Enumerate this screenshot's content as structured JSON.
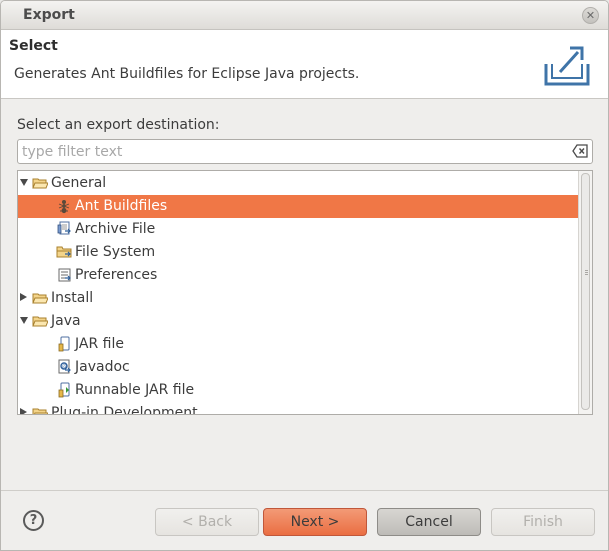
{
  "window": {
    "title": "Export",
    "close_glyph": "✕"
  },
  "header": {
    "title": "Select",
    "description": "Generates Ant Buildfiles for Eclipse Java projects.",
    "graphic_icon": "export-wizard-icon"
  },
  "prompt": "Select an export destination:",
  "filter": {
    "placeholder": "type filter text",
    "value": "",
    "clear_icon": "clear-filter-icon"
  },
  "tree": {
    "items": [
      {
        "label": "General",
        "level": 0,
        "expander": "expanded",
        "icon": "folder-open-icon"
      },
      {
        "label": "Ant Buildfiles",
        "level": 1,
        "icon": "ant-icon",
        "selected": true
      },
      {
        "label": "Archive File",
        "level": 1,
        "icon": "archive-icon"
      },
      {
        "label": "File System",
        "level": 1,
        "icon": "folder-icon"
      },
      {
        "label": "Preferences",
        "level": 1,
        "icon": "preferences-icon"
      },
      {
        "label": "Install",
        "level": 0,
        "expander": "collapsed",
        "icon": "folder-open-icon"
      },
      {
        "label": "Java",
        "level": 0,
        "expander": "expanded",
        "icon": "folder-open-icon"
      },
      {
        "label": "JAR file",
        "level": 1,
        "icon": "jar-icon"
      },
      {
        "label": "Javadoc",
        "level": 1,
        "icon": "javadoc-icon"
      },
      {
        "label": "Runnable JAR file",
        "level": 1,
        "icon": "runnable-jar-icon"
      },
      {
        "label": "Plug-in Development",
        "level": 0,
        "expander": "collapsed",
        "icon": "folder-open-icon"
      }
    ]
  },
  "buttons": {
    "help_glyph": "?",
    "back": "< Back",
    "next": "Next >",
    "cancel": "Cancel",
    "finish": "Finish"
  },
  "colors": {
    "selection": "#f07746",
    "default_button": "#ea6e42"
  }
}
